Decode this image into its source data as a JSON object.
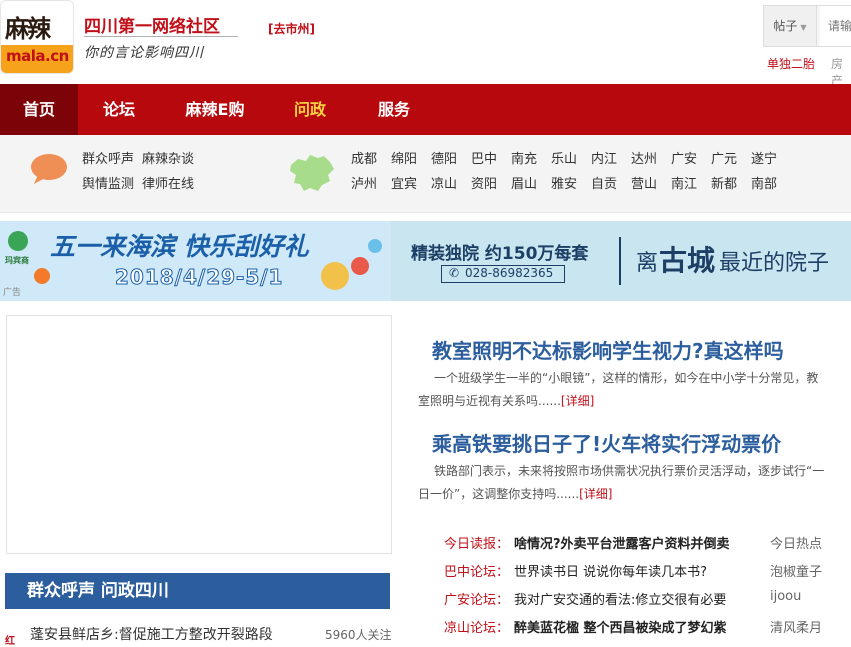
{
  "header": {
    "logo": {
      "top_text": "麻辣",
      "band_text": "mala.cn"
    },
    "site_title": "四川第一网络社区",
    "slogan": "你的言论影响四川",
    "city_link": "[去市州]",
    "search": {
      "type_label": "帖子",
      "placeholder": "请输入"
    },
    "hot_links": [
      "单独二胎",
      "房产"
    ]
  },
  "nav": {
    "items": [
      {
        "label": "首页",
        "active": true
      },
      {
        "label": "论坛"
      },
      {
        "label": "麻辣E购"
      },
      {
        "label": "问政",
        "highlight": true
      },
      {
        "label": "服务"
      }
    ]
  },
  "subnav": {
    "links": [
      "群众呼声",
      "麻辣杂谈",
      "舆情监测",
      "律师在线"
    ],
    "cities_row1": [
      "成都",
      "绵阳",
      "德阳",
      "巴中",
      "南充",
      "乐山",
      "内江",
      "达州",
      "广安",
      "广元",
      "遂宁"
    ],
    "cities_row2": [
      "泸州",
      "宜宾",
      "凉山",
      "资阳",
      "眉山",
      "雅安",
      "自贡",
      "营山",
      "南江",
      "新都",
      "南部"
    ]
  },
  "banners": {
    "left": {
      "brand": "玛宾商",
      "headline": "五一来海滨 快乐刮好礼",
      "dates": "2018/4/29-5/1",
      "ad_tag": "广告"
    },
    "right": {
      "line1": "精装独院 约150万每套",
      "phone": "028-86982365",
      "slogan_pre": "离",
      "slogan_em": "古城",
      "slogan_post": "最近的院子"
    }
  },
  "main": {
    "section_title": "群众呼声 问政四川",
    "list": [
      {
        "title": "蓬安县鲜店乡:督促施工方整改开裂路段",
        "count": "5960人关注"
      }
    ]
  },
  "news": [
    {
      "headline": "教室照明不达标影响学生视力?真这样吗",
      "summary": "一个班级学生一半的“小眼镜”，这样的情形，如今在中小学十分常见，教室照明与近视有关系吗......",
      "more": "[详细]"
    },
    {
      "headline": "乘高铁要挑日子了!火车将实行浮动票价",
      "summary": "铁路部门表示，未来将按照市场供需状况执行票价灵活浮动，逐步试行“一日一价”，这调整你支持吗......",
      "more": "[详细]"
    }
  ],
  "feed": [
    {
      "source": "今日读报：",
      "title": "啥情况?外卖平台泄露客户资料并倒卖",
      "author": "今日热点",
      "bold": true
    },
    {
      "source": "巴中论坛：",
      "title": "世界读书日 说说你每年读几本书?",
      "author": "泡椒童子"
    },
    {
      "source": "广安论坛：",
      "title": "我对广安交通的看法:修立交很有必要",
      "author": "ijoou"
    },
    {
      "source": "凉山论坛：",
      "title": "醉美蓝花楹 整个西昌被染成了梦幻紫",
      "author": "清风柔月",
      "bold": true
    }
  ],
  "colors": {
    "brand_red": "#b7080e",
    "nav_active": "#7c0408",
    "link_blue": "#2c5e9e",
    "highlight_yellow": "#ffd23f"
  }
}
